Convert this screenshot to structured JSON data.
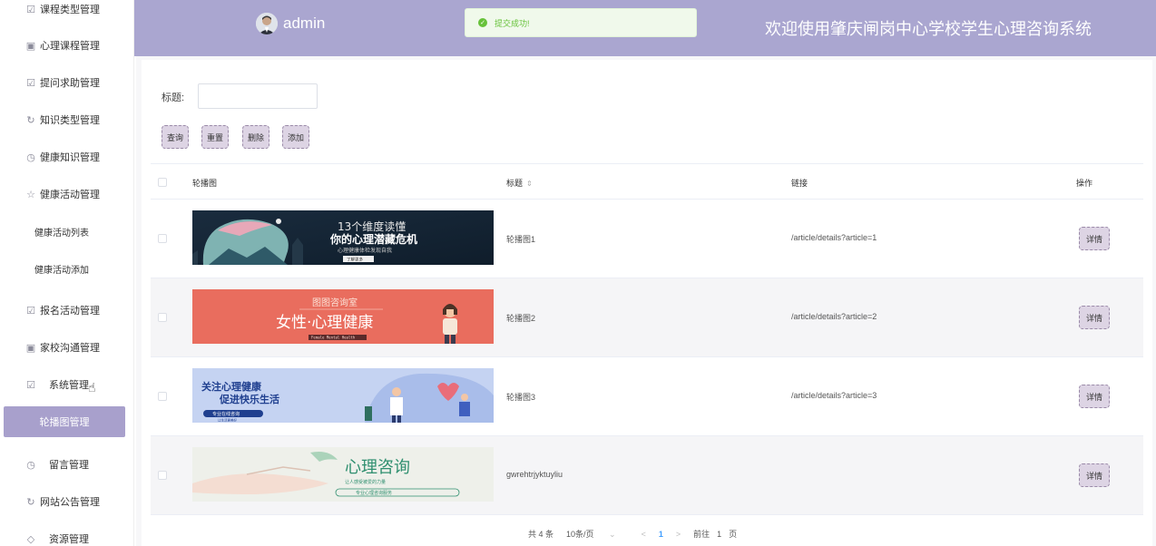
{
  "sidebar": {
    "items": [
      {
        "label": "课程类型管理",
        "icon": "checkbox-icon"
      },
      {
        "label": "心理课程管理",
        "icon": "box-icon"
      },
      {
        "label": "提问求助管理",
        "icon": "checkbox-icon"
      },
      {
        "label": "知识类型管理",
        "icon": "loop-icon"
      },
      {
        "label": "健康知识管理",
        "icon": "timer-icon"
      },
      {
        "label": "健康活动管理",
        "icon": "star-icon"
      },
      {
        "label": "健康活动列表"
      },
      {
        "label": "健康活动添加"
      },
      {
        "label": "报名活动管理",
        "icon": "checkbox-icon"
      },
      {
        "label": "家校沟通管理",
        "icon": "box-icon"
      },
      {
        "label": "系统管理",
        "icon": "checkbox-icon"
      },
      {
        "label": "轮播图管理"
      },
      {
        "label": "留言管理",
        "icon": "timer-icon"
      },
      {
        "label": "网站公告管理",
        "icon": "loop-icon"
      },
      {
        "label": "资源管理",
        "icon": "diamond-icon"
      }
    ]
  },
  "header": {
    "username": "admin",
    "toast": "提交成功!",
    "title": "欢迎使用肇庆闸岗中心学校学生心理咨询系统"
  },
  "search": {
    "label": "标题:",
    "value": ""
  },
  "toolbar": {
    "query": "查询",
    "reset": "重置",
    "delete": "删除",
    "add": "添加"
  },
  "table": {
    "headers": {
      "image": "轮播图",
      "title": "标题",
      "link": "链接",
      "action": "操作"
    },
    "rows": [
      {
        "title": "轮播图1",
        "link": "/article/details?article=1",
        "action": "详情",
        "banner": {
          "line1": "13个维度读懂",
          "line2": "你的心理潜藏危机",
          "line3": "心理健康体检发现自我",
          "btn": "了解更多"
        }
      },
      {
        "title": "轮播图2",
        "link": "/article/details?article=2",
        "action": "详情",
        "banner": {
          "line1": "图图咨询室",
          "line2": "女性·心理健康",
          "line3": "Female Mental Health"
        }
      },
      {
        "title": "轮播图3",
        "link": "/article/details?article=3",
        "action": "详情",
        "banner": {
          "line1": "关注心理健康",
          "line2": "促进快乐生活",
          "line3": "专业在线咨询",
          "line4": "让生活更美好"
        }
      },
      {
        "title": "gwrehtrjyktuyliu",
        "link": "",
        "action": "详情",
        "banner": {
          "line1": "心理咨询",
          "line2": "让人感受被爱的力量",
          "line3": "专业心理咨询服务"
        }
      }
    ]
  },
  "pagination": {
    "total": "共 4 条",
    "page_size": "10条/页",
    "prev": "<",
    "current": "1",
    "next": ">",
    "goto_label": "前往",
    "goto_value": "1",
    "page_suffix": "页"
  },
  "colors": {
    "header_bg": "#aaa6d0",
    "active_menu": "#a8a0cc",
    "button_bg": "#ddd4e4",
    "success": "#67c23a",
    "link_blue": "#409eff"
  }
}
